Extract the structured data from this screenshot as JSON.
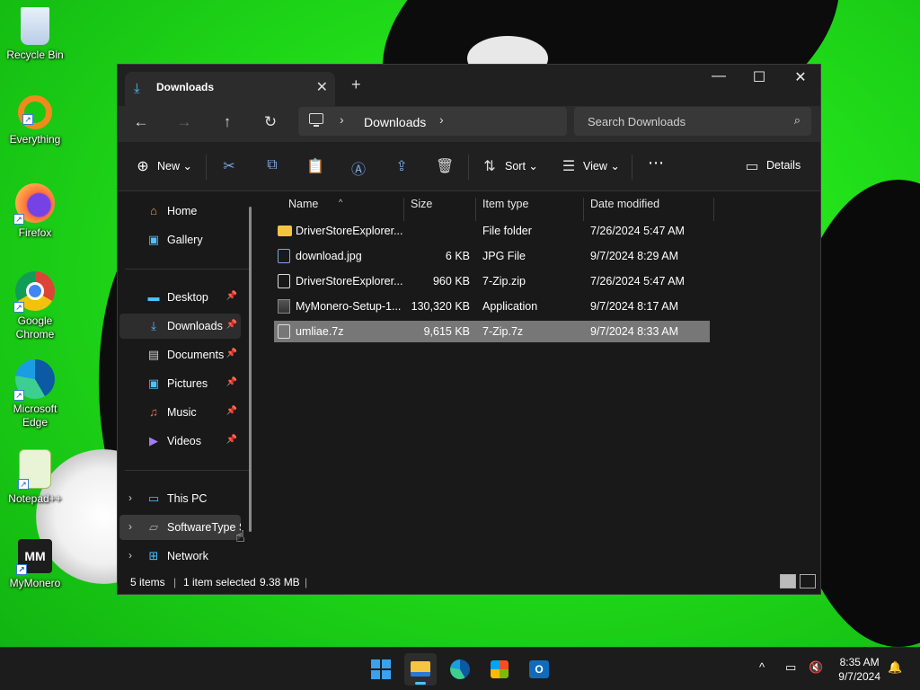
{
  "desktop": {
    "icons": [
      {
        "label": "Recycle Bin",
        "icon": "recycle-bin-icon"
      },
      {
        "label": "Everything",
        "icon": "everything-search-icon"
      },
      {
        "label": "Firefox",
        "icon": "firefox-icon"
      },
      {
        "label": "Google Chrome",
        "icon": "chrome-icon"
      },
      {
        "label": "Microsoft Edge",
        "icon": "edge-icon"
      },
      {
        "label": "Notepad++",
        "icon": "notepadpp-icon"
      },
      {
        "label": "MyMonero",
        "icon": "mymonero-icon"
      }
    ]
  },
  "window": {
    "tab_title": "Downloads",
    "address": {
      "crumb": "Downloads"
    },
    "search": {
      "placeholder": "Search Downloads"
    },
    "commands": {
      "new": "New",
      "sort": "Sort",
      "view": "View",
      "details": "Details"
    },
    "sidebar": {
      "top": [
        {
          "label": "Home",
          "icon": "home-icon"
        },
        {
          "label": "Gallery",
          "icon": "gallery-icon"
        }
      ],
      "pinned": [
        {
          "label": "Desktop",
          "icon": "desktop-folder-icon"
        },
        {
          "label": "Downloads",
          "icon": "downloads-folder-icon"
        },
        {
          "label": "Documents",
          "icon": "documents-folder-icon"
        },
        {
          "label": "Pictures",
          "icon": "pictures-folder-icon"
        },
        {
          "label": "Music",
          "icon": "music-folder-icon"
        },
        {
          "label": "Videos",
          "icon": "videos-folder-icon"
        }
      ],
      "bottom": [
        {
          "label": "This PC",
          "icon": "this-pc-icon"
        },
        {
          "label": "SoftwareType St",
          "icon": "drive-icon"
        },
        {
          "label": "Network",
          "icon": "network-icon"
        }
      ]
    },
    "columns": {
      "name": "Name",
      "size": "Size",
      "type": "Item type",
      "date": "Date modified"
    },
    "files": [
      {
        "name": "DriverStoreExplorer....",
        "size": "",
        "type": "File folder",
        "date": "7/26/2024 5:47 AM",
        "icon": "folder"
      },
      {
        "name": "download.jpg",
        "size": "6 KB",
        "type": "JPG File",
        "date": "9/7/2024 8:29 AM",
        "icon": "image"
      },
      {
        "name": "DriverStoreExplorer....",
        "size": "960 KB",
        "type": "7-Zip.zip",
        "date": "7/26/2024 5:47 AM",
        "icon": "file"
      },
      {
        "name": "MyMonero-Setup-1...",
        "size": "130,320 KB",
        "type": "Application",
        "date": "9/7/2024 8:17 AM",
        "icon": "app"
      },
      {
        "name": "umliae.7z",
        "size": "9,615 KB",
        "type": "7-Zip.7z",
        "date": "9/7/2024 8:33 AM",
        "icon": "file"
      }
    ],
    "status": {
      "items": "5 items",
      "selected": "1 item selected",
      "size": "9.38 MB"
    }
  },
  "taskbar": {
    "clock_time": "8:35 AM",
    "clock_date": "9/7/2024"
  }
}
